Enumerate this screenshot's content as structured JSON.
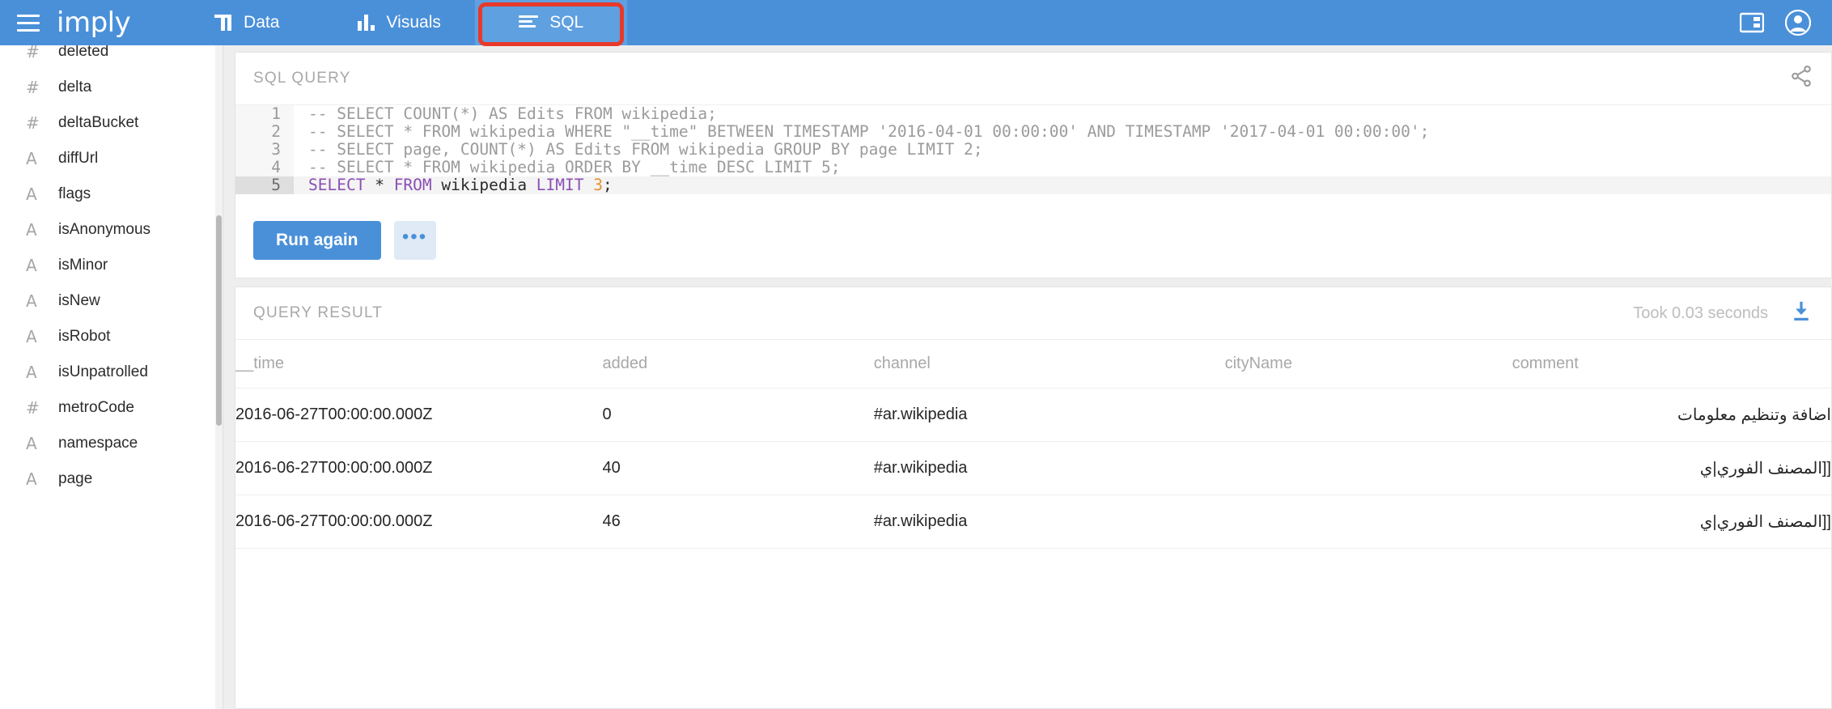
{
  "header": {
    "brand": "imply",
    "menu_icon": "hamburger-icon",
    "tabs": [
      {
        "label": "Data",
        "icon": "data-grid-icon",
        "active": false
      },
      {
        "label": "Visuals",
        "icon": "bar-chart-icon",
        "active": false
      },
      {
        "label": "SQL",
        "icon": "sql-lines-icon",
        "active": true
      }
    ],
    "right_icons": [
      {
        "name": "split-panel-icon"
      },
      {
        "name": "account-circle-icon"
      }
    ],
    "highlight_color": "#e8392a",
    "bar_color": "#4a90d9"
  },
  "sidebar": {
    "fields": [
      {
        "type": "#",
        "label": "deleted"
      },
      {
        "type": "#",
        "label": "delta"
      },
      {
        "type": "#",
        "label": "deltaBucket"
      },
      {
        "type": "A",
        "label": "diffUrl"
      },
      {
        "type": "A",
        "label": "flags"
      },
      {
        "type": "A",
        "label": "isAnonymous"
      },
      {
        "type": "A",
        "label": "isMinor"
      },
      {
        "type": "A",
        "label": "isNew"
      },
      {
        "type": "A",
        "label": "isRobot"
      },
      {
        "type": "A",
        "label": "isUnpatrolled"
      },
      {
        "type": "#",
        "label": "metroCode"
      },
      {
        "type": "A",
        "label": "namespace"
      },
      {
        "type": "A",
        "label": "page"
      }
    ]
  },
  "query_panel": {
    "title": "SQL QUERY",
    "share_icon": "share-icon",
    "lines": [
      {
        "n": "1",
        "text": "-- SELECT COUNT(*) AS Edits FROM wikipedia;",
        "current": false
      },
      {
        "n": "2",
        "text": "-- SELECT * FROM wikipedia WHERE \"__time\" BETWEEN TIMESTAMP '2016-04-01 00:00:00' AND TIMESTAMP '2017-04-01 00:00:00';",
        "current": false
      },
      {
        "n": "3",
        "text": "-- SELECT page, COUNT(*) AS Edits FROM wikipedia GROUP BY page LIMIT 2;",
        "current": false
      },
      {
        "n": "4",
        "text": "-- SELECT * FROM wikipedia ORDER BY __time DESC LIMIT 5;",
        "current": false
      },
      {
        "n": "5",
        "text": "SELECT * FROM wikipedia LIMIT 3;",
        "current": true
      }
    ],
    "run_button": "Run again",
    "more_button": "•••"
  },
  "result_panel": {
    "title": "QUERY RESULT",
    "took": "Took 0.03 seconds",
    "download_icon": "download-icon",
    "columns": [
      "__time",
      "added",
      "channel",
      "cityName",
      "comment"
    ],
    "rows": [
      {
        "__time": "2016-06-27T00:00:00.000Z",
        "added": "0",
        "channel": "#ar.wikipedia",
        "cityName": "",
        "comment": "اضافة وتنظيم معلومات"
      },
      {
        "__time": "2016-06-27T00:00:00.000Z",
        "added": "40",
        "channel": "#ar.wikipedia",
        "cityName": "",
        "comment": "[[المصنف الفوري|ي"
      },
      {
        "__time": "2016-06-27T00:00:00.000Z",
        "added": "46",
        "channel": "#ar.wikipedia",
        "cityName": "",
        "comment": "[[المصنف الفوري|ي"
      }
    ]
  }
}
